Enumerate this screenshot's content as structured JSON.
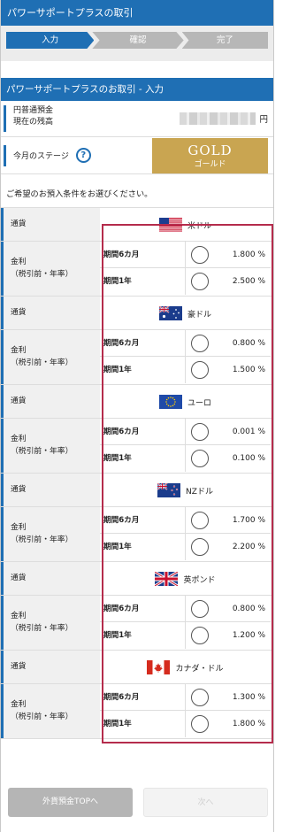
{
  "header": {
    "title": "パワーサポートプラスの取引"
  },
  "steps": [
    "入力",
    "確認",
    "完了"
  ],
  "section_title": "パワーサポートプラスのお取引 - 入力",
  "balance": {
    "label_line1": "円普通預金",
    "label_line2": "現在の残高",
    "unit": "円"
  },
  "stage": {
    "label": "今月のステージ",
    "help_glyph": "?",
    "badge_main": "GOLD",
    "badge_sub": "ゴールド"
  },
  "guide_text": "ご希望のお預入条件をお選びください。",
  "row_labels": {
    "currency": "通貨",
    "rate_line1": "金利",
    "rate_line2": "（税引前・年率）"
  },
  "currencies": [
    {
      "name": "米ドル",
      "flag": "us-flag-icon",
      "opts": [
        {
          "term": "期間6カ月",
          "rate": "1.800 %"
        },
        {
          "term": "期間1年",
          "rate": "2.500 %"
        }
      ]
    },
    {
      "name": "豪ドル",
      "flag": "au-flag-icon",
      "opts": [
        {
          "term": "期間6カ月",
          "rate": "0.800 %"
        },
        {
          "term": "期間1年",
          "rate": "1.500 %"
        }
      ]
    },
    {
      "name": "ユーロ",
      "flag": "eu-flag-icon",
      "opts": [
        {
          "term": "期間6カ月",
          "rate": "0.001 %"
        },
        {
          "term": "期間1年",
          "rate": "0.100 %"
        }
      ]
    },
    {
      "name": "NZドル",
      "flag": "nz-flag-icon",
      "opts": [
        {
          "term": "期間6カ月",
          "rate": "1.700 %"
        },
        {
          "term": "期間1年",
          "rate": "2.200 %"
        }
      ]
    },
    {
      "name": "英ポンド",
      "flag": "uk-flag-icon",
      "opts": [
        {
          "term": "期間6カ月",
          "rate": "0.800 %"
        },
        {
          "term": "期間1年",
          "rate": "1.200 %"
        }
      ]
    },
    {
      "name": "カナダ・ドル",
      "flag": "ca-flag-icon",
      "opts": [
        {
          "term": "期間6カ月",
          "rate": "1.300 %"
        },
        {
          "term": "期間1年",
          "rate": "1.800 %"
        }
      ]
    }
  ],
  "buttons": {
    "back": "外貨預金TOPへ",
    "next": "次へ"
  },
  "colors": {
    "primary": "#1f6fb4",
    "gold": "#c9a551",
    "highlight": "#b52c4c"
  }
}
